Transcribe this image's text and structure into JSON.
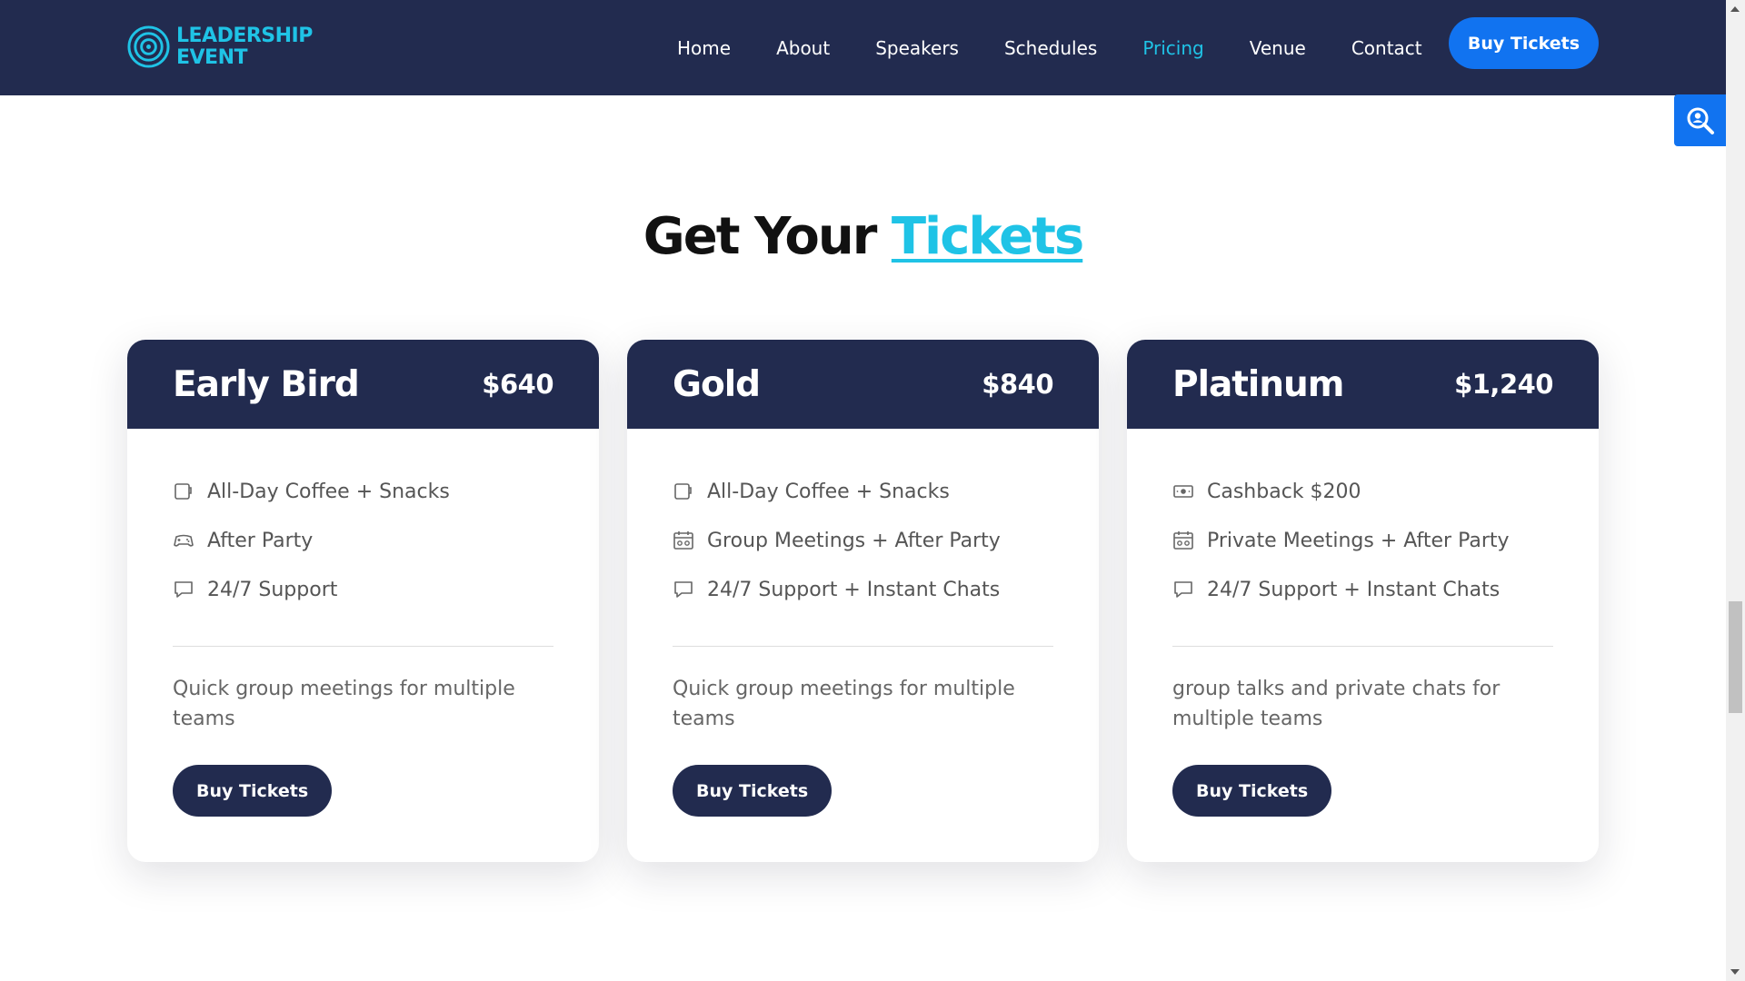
{
  "header": {
    "logo_line1": "LEADERSHIP",
    "logo_line2": "EVENT",
    "nav": [
      {
        "label": "Home",
        "active": false
      },
      {
        "label": "About",
        "active": false
      },
      {
        "label": "Speakers",
        "active": false
      },
      {
        "label": "Schedules",
        "active": false
      },
      {
        "label": "Pricing",
        "active": true
      },
      {
        "label": "Venue",
        "active": false
      },
      {
        "label": "Contact",
        "active": false
      }
    ],
    "cta_label": "Buy Tickets"
  },
  "side_tab": {
    "icon": "search-user-icon"
  },
  "section": {
    "title_main": "Get Your",
    "title_accent": "Tickets"
  },
  "cards": [
    {
      "name": "Early Bird",
      "price": "$640",
      "features": [
        {
          "icon": "coffee-cup-icon",
          "text": "All-Day Coffee + Snacks"
        },
        {
          "icon": "gamepad-icon",
          "text": "After Party"
        },
        {
          "icon": "chat-bubble-icon",
          "text": "24/7 Support"
        }
      ],
      "description": "Quick group meetings for multiple teams",
      "button_label": "Buy Tickets"
    },
    {
      "name": "Gold",
      "price": "$840",
      "features": [
        {
          "icon": "coffee-cup-icon",
          "text": "All-Day Coffee + Snacks"
        },
        {
          "icon": "calendar-icon",
          "text": "Group Meetings + After Party"
        },
        {
          "icon": "chat-bubble-icon",
          "text": "24/7 Support + Instant Chats"
        }
      ],
      "description": "Quick group meetings for multiple teams",
      "button_label": "Buy Tickets"
    },
    {
      "name": "Platinum",
      "price": "$1,240",
      "features": [
        {
          "icon": "cash-icon",
          "text": "Cashback $200"
        },
        {
          "icon": "calendar-icon",
          "text": "Private Meetings + After Party"
        },
        {
          "icon": "chat-bubble-icon",
          "text": "24/7 Support + Instant Chats"
        }
      ],
      "description": "group talks and private chats for multiple teams",
      "button_label": "Buy Tickets"
    }
  ],
  "colors": {
    "navy": "#222b4f",
    "accent_cyan": "#1fc3e6",
    "cta_blue": "#1173f0"
  }
}
